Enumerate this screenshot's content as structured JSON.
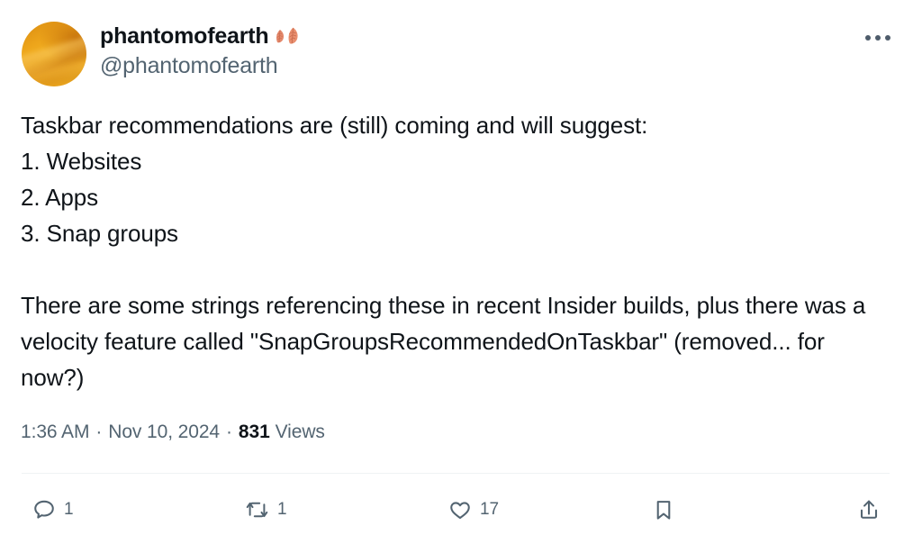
{
  "post": {
    "author": {
      "display_name": "phantomofearth",
      "handle": "@phantomofearth",
      "name_emoji": "🍂🍂",
      "avatar_name": "avatar-phantomofearth",
      "avatar_colors": [
        "#d98a10",
        "#f3b62a",
        "#c8740c"
      ]
    },
    "more_button_label": "More",
    "text": "Taskbar recommendations are (still) coming and will suggest:\n1. Websites\n2. Apps\n3. Snap groups\n\nThere are some strings referencing these in recent Insider builds, plus there was a velocity feature called \"SnapGroupsRecommendedOnTaskbar\" (removed... for now?)",
    "meta": {
      "time": "1:36 AM",
      "separator": "·",
      "date": "Nov 10, 2024",
      "views_count": "831",
      "views_label": "Views"
    },
    "actions": [
      {
        "name": "reply",
        "icon": "reply-icon",
        "count": "1"
      },
      {
        "name": "retweet",
        "icon": "retweet-icon",
        "count": "1"
      },
      {
        "name": "like",
        "icon": "heart-icon",
        "count": "17"
      },
      {
        "name": "bookmark",
        "icon": "bookmark-icon",
        "count": ""
      },
      {
        "name": "share",
        "icon": "share-icon",
        "count": ""
      }
    ]
  },
  "colors": {
    "text": "#0f1419",
    "muted": "#536471",
    "divider": "#eff3f4",
    "background": "#ffffff"
  }
}
